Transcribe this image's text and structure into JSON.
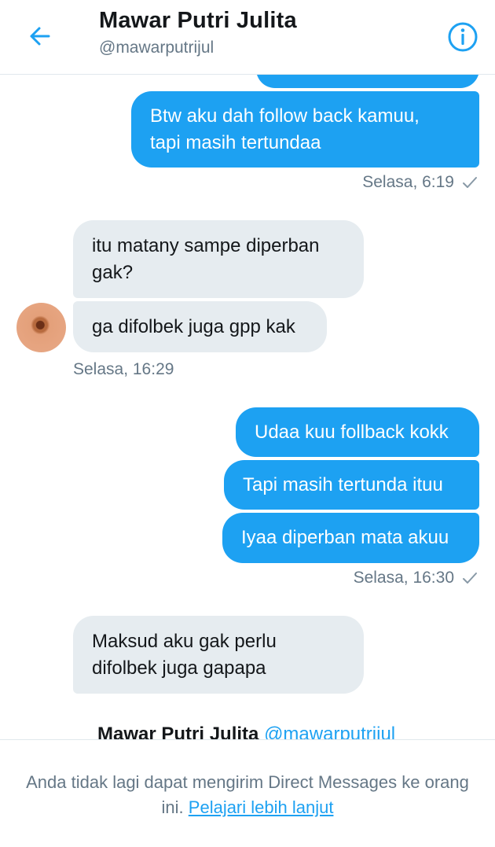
{
  "header": {
    "title": "Mawar Putri Julita",
    "handle": "@mawarputrijul",
    "back_icon": "arrow-left-icon",
    "info_icon": "info-circle-icon"
  },
  "messages": [
    {
      "direction": "out",
      "text": ""
    },
    {
      "direction": "out",
      "text": "Btw aku dah follow back kamuu,\ntapi masih tertundaa"
    },
    {
      "direction": "in",
      "text": "itu matany sampe diperban\ngak?"
    },
    {
      "direction": "in",
      "text": "ga difolbek juga gpp kak"
    },
    {
      "direction": "out",
      "text": "Udaa kuu follback kokk"
    },
    {
      "direction": "out",
      "text": "Tapi masih tertunda ituu"
    },
    {
      "direction": "out",
      "text": "Iyaa diperban mata akuu"
    },
    {
      "direction": "in",
      "text": "Maksud aku gak perlu\ndifolbek juga gapapa"
    }
  ],
  "timestamps": [
    {
      "text": "Selasa, 6:19",
      "read": true
    },
    {
      "text": "Selasa, 16:29",
      "read": false
    },
    {
      "text": "Selasa, 16:30",
      "read": true
    }
  ],
  "peek": {
    "name": "Mawar Putri Julita",
    "handle": "@mawarputrijul"
  },
  "footer": {
    "text": "Anda tidak lagi dapat mengirim Direct Messages ke orang ini.",
    "link": "Pelajari lebih lanjut"
  },
  "colors": {
    "accent": "#1da1f2",
    "incoming_bubble": "#e6ecf0",
    "secondary_text": "#657786"
  }
}
